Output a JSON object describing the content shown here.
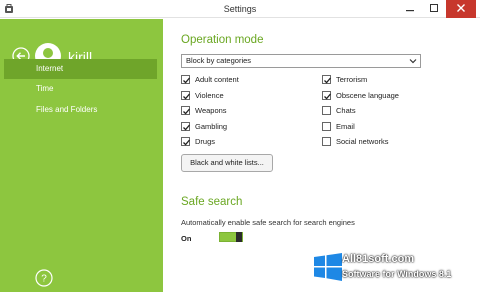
{
  "window": {
    "title": "Settings",
    "minimize_icon": "minimize-icon",
    "maximize_icon": "maximize-icon",
    "close_icon": "close-icon"
  },
  "sidebar": {
    "username": "kirill",
    "items": [
      {
        "label": "Internet",
        "active": true
      },
      {
        "label": "Time",
        "active": false
      },
      {
        "label": "Files and Folders",
        "active": false
      }
    ],
    "accent_color": "#8dc63f",
    "active_color": "#6fa52a"
  },
  "operation_mode": {
    "title": "Operation mode",
    "dropdown_value": "Block by categories",
    "left_categories": [
      {
        "label": "Adult content",
        "checked": true
      },
      {
        "label": "Violence",
        "checked": true
      },
      {
        "label": "Weapons",
        "checked": true
      },
      {
        "label": "Gambling",
        "checked": true
      },
      {
        "label": "Drugs",
        "checked": true
      }
    ],
    "right_categories": [
      {
        "label": "Terrorism",
        "checked": true
      },
      {
        "label": "Obscene language",
        "checked": true
      },
      {
        "label": "Chats",
        "checked": false
      },
      {
        "label": "Email",
        "checked": false
      },
      {
        "label": "Social networks",
        "checked": false
      }
    ],
    "lists_button": "Black and white lists..."
  },
  "safe_search": {
    "title": "Safe search",
    "description": "Automatically enable safe search for search engines",
    "state_label": "On",
    "enabled": true
  },
  "watermark": {
    "site": "All81soft.com",
    "subtitle": "Software for Windows 8.1"
  }
}
